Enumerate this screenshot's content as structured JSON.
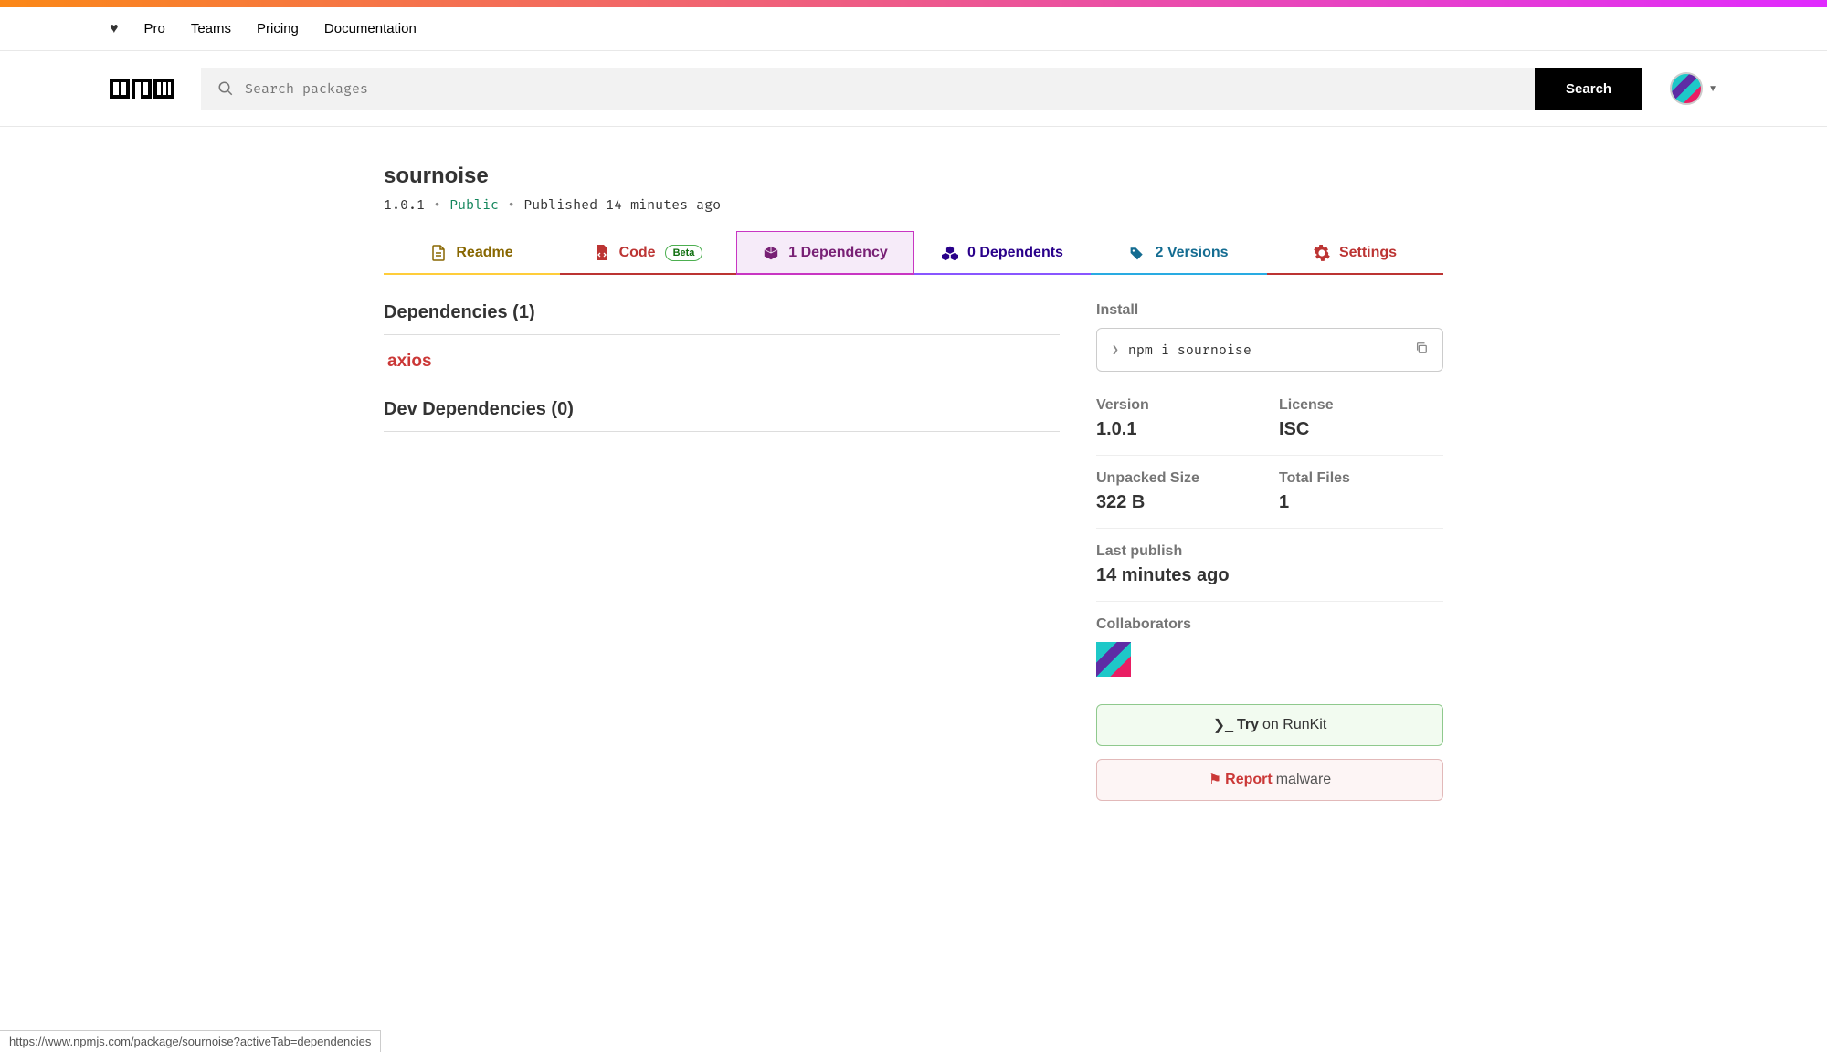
{
  "topnav": {
    "links": [
      "Pro",
      "Teams",
      "Pricing",
      "Documentation"
    ]
  },
  "search": {
    "placeholder": "Search packages",
    "button": "Search"
  },
  "package": {
    "name": "sournoise",
    "version": "1.0.1",
    "visibility": "Public",
    "published": "Published 14 minutes ago"
  },
  "tabs": {
    "readme": "Readme",
    "code": "Code",
    "code_badge": "Beta",
    "dependency": "1 Dependency",
    "dependents": "0 Dependents",
    "versions": "2 Versions",
    "settings": "Settings"
  },
  "deps": {
    "heading": "Dependencies (1)",
    "items": [
      "axios"
    ],
    "dev_heading": "Dev Dependencies (0)"
  },
  "sidebar": {
    "install_label": "Install",
    "install_cmd": "npm i sournoise",
    "version_label": "Version",
    "version_value": "1.0.1",
    "license_label": "License",
    "license_value": "ISC",
    "size_label": "Unpacked Size",
    "size_value": "322 B",
    "files_label": "Total Files",
    "files_value": "1",
    "lastpub_label": "Last publish",
    "lastpub_value": "14 minutes ago",
    "collab_label": "Collaborators",
    "runkit_try": "Try",
    "runkit_on": " on RunKit",
    "report": "Report",
    "report_rest": " malware"
  },
  "status_url": "https://www.npmjs.com/package/sournoise?activeTab=dependencies"
}
